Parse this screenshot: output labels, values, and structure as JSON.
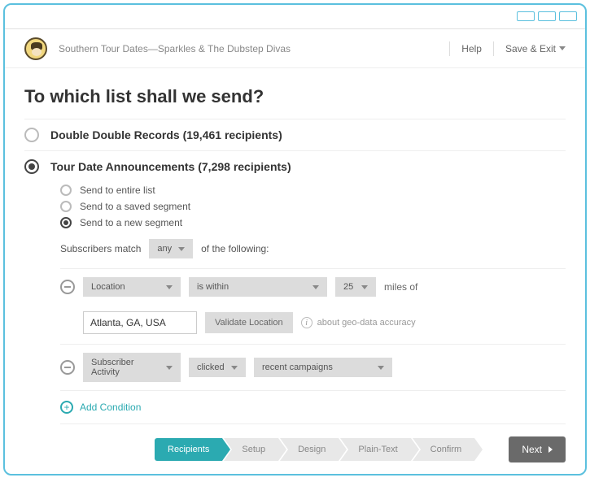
{
  "header": {
    "campaign_name": "Southern Tour Dates—Sparkles & The Dubstep Divas",
    "help_label": "Help",
    "save_exit_label": "Save & Exit"
  },
  "title": "To which list shall we send?",
  "lists": [
    {
      "id": "ddr",
      "label": "Double Double Records (19,461 recipients)",
      "selected": false
    },
    {
      "id": "tda",
      "label": "Tour Date Announcements (7,298 recipients)",
      "selected": true
    }
  ],
  "segment_options": [
    {
      "label": "Send to entire list",
      "selected": false
    },
    {
      "label": "Send to a saved segment",
      "selected": false
    },
    {
      "label": "Send to a new segment",
      "selected": true
    }
  ],
  "match": {
    "prefix": "Subscribers match",
    "mode": "any",
    "suffix": "of the following:"
  },
  "conditions": {
    "c0": {
      "field": "Location",
      "operator": "is within",
      "distance": "25",
      "unit_text": "miles of",
      "value": "Atlanta, GA, USA",
      "validate_label": "Validate Location",
      "info_text": "about geo-data accuracy"
    },
    "c1": {
      "field": "Subscriber Activity",
      "operator": "clicked",
      "target": "recent campaigns"
    }
  },
  "add_condition_label": "Add Condition",
  "steps": [
    "Recipients",
    "Setup",
    "Design",
    "Plain-Text",
    "Confirm"
  ],
  "active_step": 0,
  "next_label": "Next"
}
